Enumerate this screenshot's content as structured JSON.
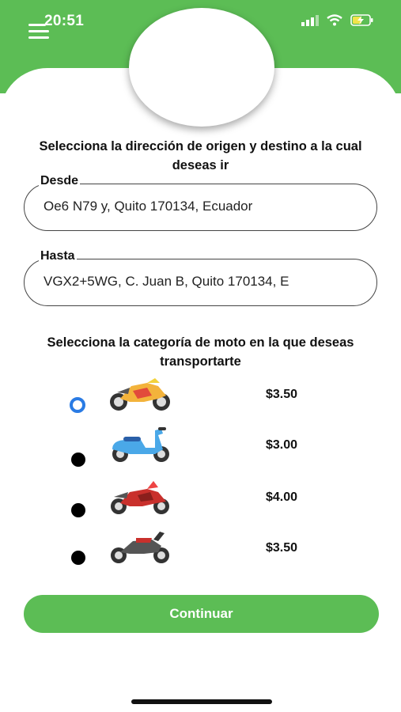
{
  "status_bar": {
    "time": "20:51"
  },
  "origin_destination": {
    "title": "Selecciona la dirección de origen y destino a la cual deseas ir",
    "from": {
      "label": "Desde",
      "value": "Oe6 N79 y, Quito 170134, Ecuador"
    },
    "to": {
      "label": "Hasta",
      "value": "VGX2+5WG, C. Juan B, Quito 170134, E"
    }
  },
  "category": {
    "title": "Selecciona la categoría de moto en la que deseas transportarte",
    "options": [
      {
        "icon": "sport-motorcycle-orange-icon",
        "price": "$3.50",
        "selected": true
      },
      {
        "icon": "scooter-blue-icon",
        "price": "$3.00",
        "selected": false
      },
      {
        "icon": "sport-motorcycle-red-icon",
        "price": "$4.00",
        "selected": false
      },
      {
        "icon": "classic-motorcycle-icon",
        "price": "$3.50",
        "selected": false
      }
    ]
  },
  "continue_button": {
    "label": "Continuar"
  },
  "colors": {
    "brand_green": "#5cbd55",
    "radio_selected": "#2a7be4"
  }
}
